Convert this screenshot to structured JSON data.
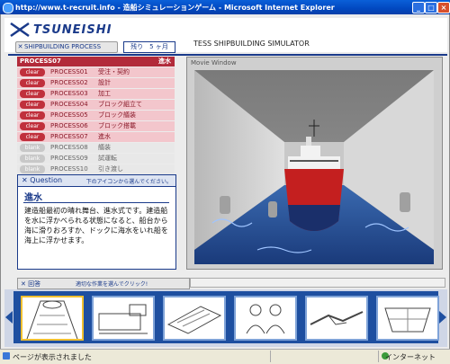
{
  "window": {
    "title": "http://www.t-recruit.info - 造船シミュレーションゲーム - Microsoft Internet Explorer",
    "minimize_glyph": "_",
    "maximize_glyph": "□",
    "close_glyph": "×"
  },
  "header": {
    "logo_text": "TSUNEISHI",
    "simulator_title": "TESS SHIPBUILDING SIMULATOR",
    "tab_label": "SHIPBUILDING PROCESS",
    "tab_icon_glyph": "✕",
    "month_label": "残り　5 ヶ月"
  },
  "process": {
    "current_label": "PROCESS07",
    "current_name": "進水",
    "items": [
      {
        "badge": "clear",
        "number": "PROCESS01",
        "name": "受注・契約",
        "state": "done"
      },
      {
        "badge": "clear",
        "number": "PROCESS02",
        "name": "設計",
        "state": "done"
      },
      {
        "badge": "clear",
        "number": "PROCESS03",
        "name": "加工",
        "state": "done"
      },
      {
        "badge": "clear",
        "number": "PROCESS04",
        "name": "ブロック組立て",
        "state": "done"
      },
      {
        "badge": "clear",
        "number": "PROCESS05",
        "name": "ブロック艤装",
        "state": "done"
      },
      {
        "badge": "clear",
        "number": "PROCESS06",
        "name": "ブロック搭載",
        "state": "done"
      },
      {
        "badge": "clear",
        "number": "PROCESS07",
        "name": "進水",
        "state": "done"
      },
      {
        "badge": "blank",
        "number": "PROCESS08",
        "name": "艤装",
        "state": "todo"
      },
      {
        "badge": "blank",
        "number": "PROCESS09",
        "name": "試運転",
        "state": "todo"
      },
      {
        "badge": "blank",
        "number": "PROCESS10",
        "name": "引き渡し",
        "state": "todo"
      }
    ]
  },
  "question": {
    "label": "Question",
    "icon_glyph": "✕",
    "instruction": "下のアイコンから選んでください。",
    "term": "進水",
    "description": "建造船最初の晴れ舞台、進水式です。建造船を水に浮かべられる状態になると、船台から海に滑りおろすか、ドックに海水をいれ船を海上に浮かせます。"
  },
  "movie": {
    "label": "Movie Window"
  },
  "answer": {
    "label": "回答",
    "icon_glyph": "✕",
    "instruction": "適切な作業を選んでクリック!"
  },
  "thumbnails": [
    {
      "name": "tunnel-thumbnail",
      "selected": true
    },
    {
      "name": "machinery-thumbnail",
      "selected": false
    },
    {
      "name": "blueprint-thumbnail",
      "selected": false
    },
    {
      "name": "ceremony-thumbnail",
      "selected": false
    },
    {
      "name": "handshake-thumbnail",
      "selected": false
    },
    {
      "name": "hull-thumbnail",
      "selected": false
    }
  ],
  "statusbar": {
    "status_text": "ページが表示されました",
    "zone_text": "インターネット"
  },
  "colors": {
    "brand_blue": "#1a3a8a",
    "clear_red": "#c0303c",
    "done_pink": "#f3c6cc"
  }
}
